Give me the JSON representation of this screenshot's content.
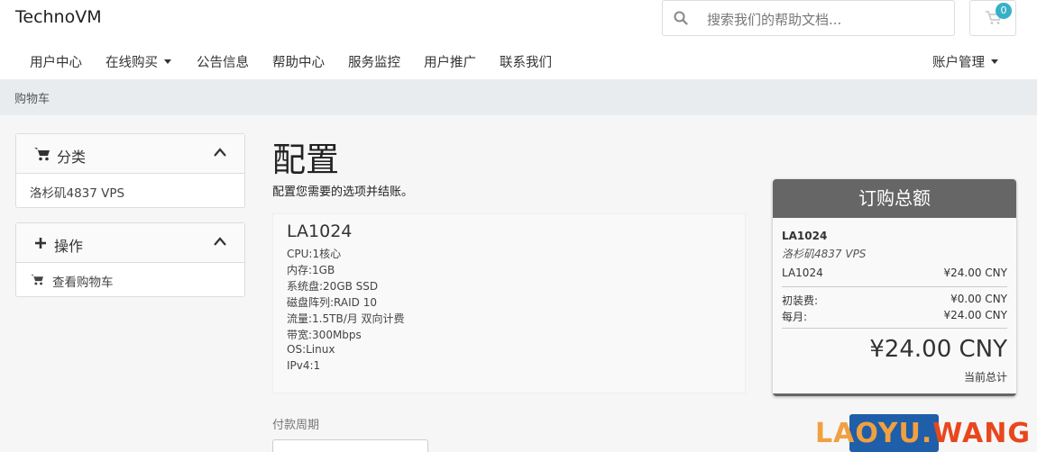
{
  "header": {
    "brand": "TechnoVM",
    "search_placeholder": "搜索我们的帮助文档...",
    "cart_count": "0"
  },
  "nav": {
    "items": [
      {
        "label": "用户中心"
      },
      {
        "label": "在线购买"
      },
      {
        "label": "公告信息"
      },
      {
        "label": "帮助中心"
      },
      {
        "label": "服务监控"
      },
      {
        "label": "用户推广"
      },
      {
        "label": "联系我们"
      }
    ],
    "account": "账户管理"
  },
  "breadcrumb": "购物车",
  "sidebar": {
    "categories_title": "分类",
    "categories_item": "洛杉矶4837 VPS",
    "actions_title": "操作",
    "actions_item": "查看购物车"
  },
  "main": {
    "title": "配置",
    "subtitle": "配置您需要的选项并结账。",
    "product": {
      "name": "LA1024",
      "specs": [
        "CPU:1核心",
        "内存:1GB",
        "系统盘:20GB SSD",
        "磁盘阵列:RAID 10",
        "流量:1.5TB/月 双向计费",
        "带宽:300Mbps",
        "OS:Linux",
        "IPv4:1"
      ]
    },
    "billing_cycle_label": "付款周期"
  },
  "summary": {
    "title": "订购总额",
    "product_name": "LA1024",
    "product_group": "洛杉矶4837 VPS",
    "line_label": "LA1024",
    "line_price": "¥24.00 CNY",
    "setup_label": "初装费:",
    "setup_price": "¥0.00 CNY",
    "monthly_label": "每月:",
    "monthly_price": "¥24.00 CNY",
    "total": "¥24.00 CNY",
    "total_note": "当前总计"
  },
  "watermark": {
    "part1": "LAOYU.",
    "part2": "WANG"
  },
  "colors": {
    "badge": "#37b0c8",
    "summary_header": "#666666",
    "checkout_button": "#1f5ea8",
    "watermark_orange": "#f0a040",
    "watermark_red": "#e8471d"
  }
}
